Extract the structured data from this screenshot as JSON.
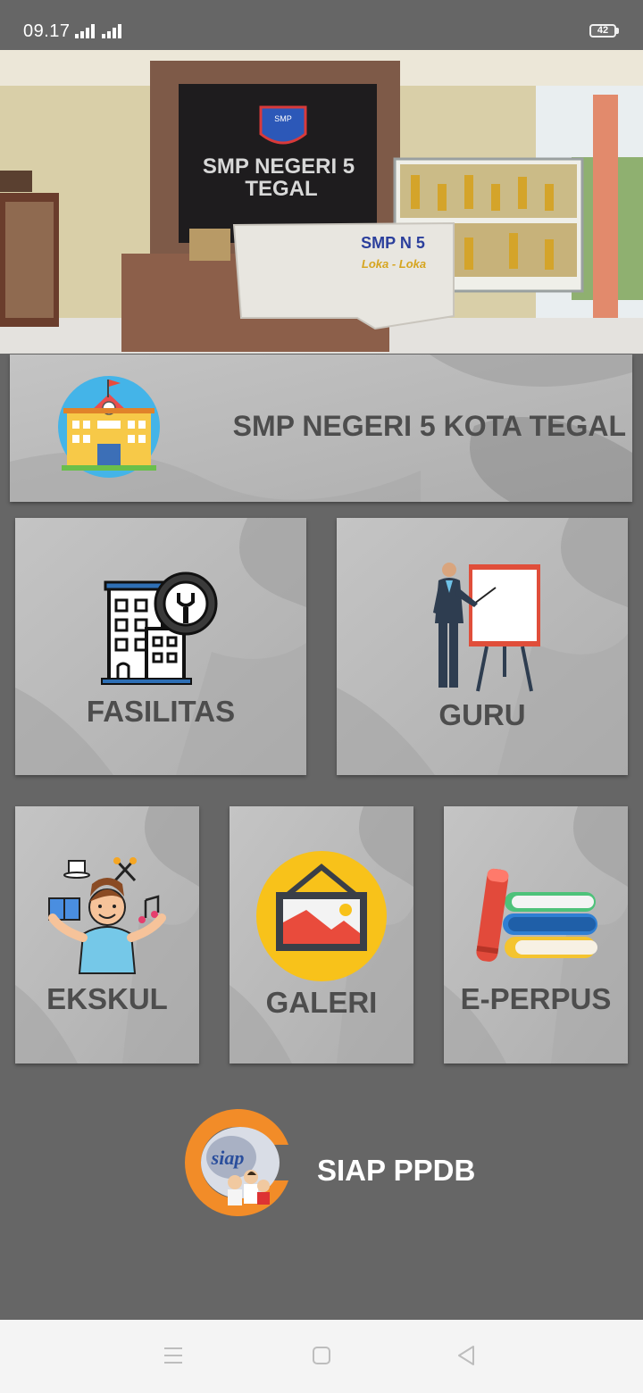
{
  "status_bar": {
    "time": "09.17",
    "battery_level": "42"
  },
  "hero": {
    "sign_line1": "SMP NEGERI 5",
    "sign_line2": "TEGAL",
    "desk_line1": "SMP N 5",
    "desk_line2": "Loka - Loka",
    "emblem_text": "SMP"
  },
  "school_card": {
    "title": "SMP NEGERI 5 KOTA TEGAL"
  },
  "menu": {
    "fasilitas": "FASILITAS",
    "guru": "GURU",
    "ekskul": "EKSKUL",
    "galeri": "GALERI",
    "eperpus": "E-PERPUS"
  },
  "ppdb": {
    "label": "SIAP PPDB",
    "logo_text": "siap"
  },
  "icons": {
    "school": "school-building-icon",
    "fasilitas": "building-gear-icon",
    "guru": "teacher-board-icon",
    "ekskul": "student-hobbies-icon",
    "galeri": "picture-frame-icon",
    "eperpus": "books-icon",
    "ppdb": "siap-ppdb-logo"
  },
  "colors": {
    "background": "#666666",
    "card": "#b9b9b9",
    "card_text": "#4d4d4d",
    "ppdb_accent": "#f28c28"
  }
}
